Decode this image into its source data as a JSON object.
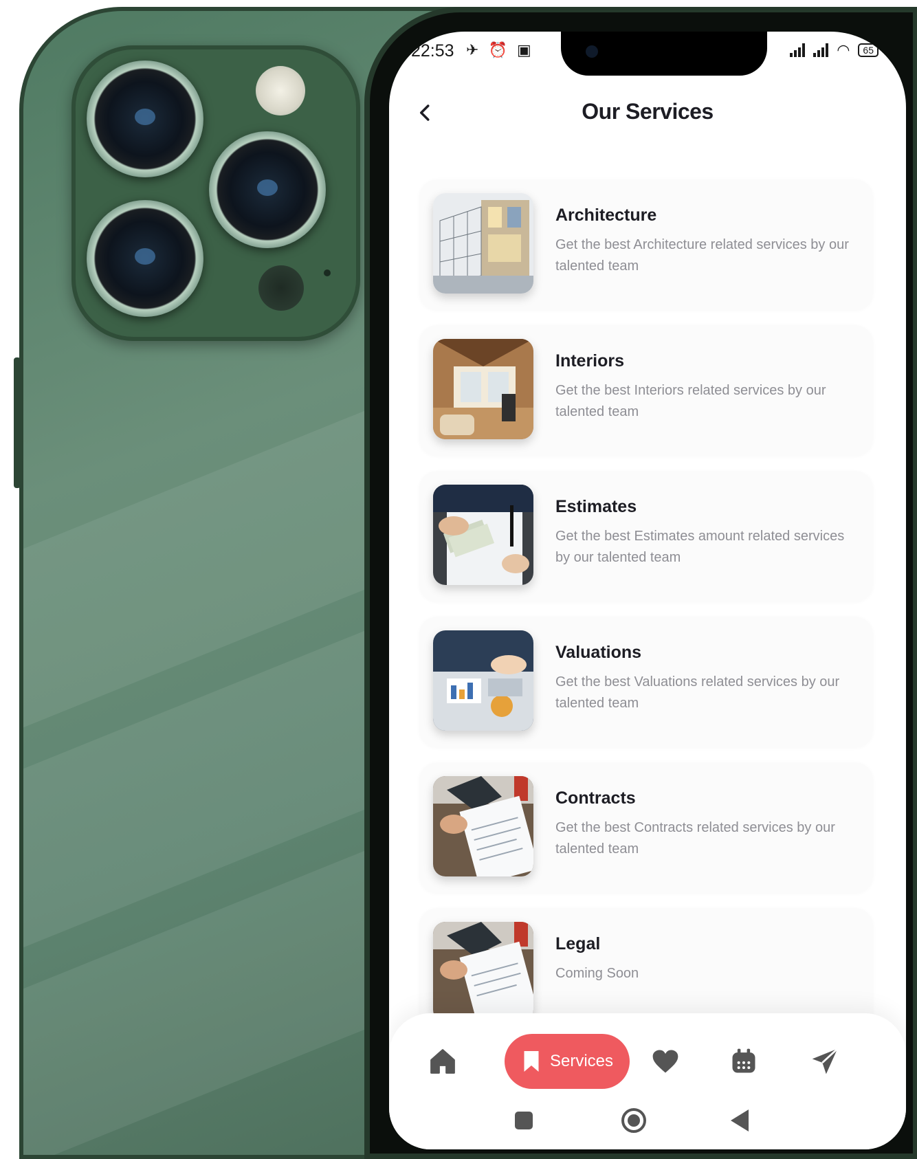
{
  "status_bar": {
    "time": "22:53",
    "left_icons": "✈ ⏰ ▣",
    "battery": "65"
  },
  "header": {
    "title": "Our Services"
  },
  "services": [
    {
      "title": "Architecture",
      "description": "Get the best Architecture related services by our talented team"
    },
    {
      "title": "Interiors",
      "description": "Get the best Interiors related services by our talented team"
    },
    {
      "title": "Estimates",
      "description": "Get the best Estimates amount related services by our talented team"
    },
    {
      "title": "Valuations",
      "description": "Get the best Valuations related services by our talented team"
    },
    {
      "title": "Contracts",
      "description": "Get the best Contracts related services by our talented team"
    },
    {
      "title": "Legal",
      "description": "Coming Soon"
    }
  ],
  "bottom_nav": {
    "active_label": "Services",
    "items": [
      "home-icon",
      "bookmark-icon",
      "heart-icon",
      "calendar-icon",
      "send-icon"
    ]
  },
  "colors": {
    "accent": "#ef5a5f",
    "nav_icon": "#555555",
    "title_text": "#1d1d24",
    "secondary_text": "#8e8e94"
  }
}
